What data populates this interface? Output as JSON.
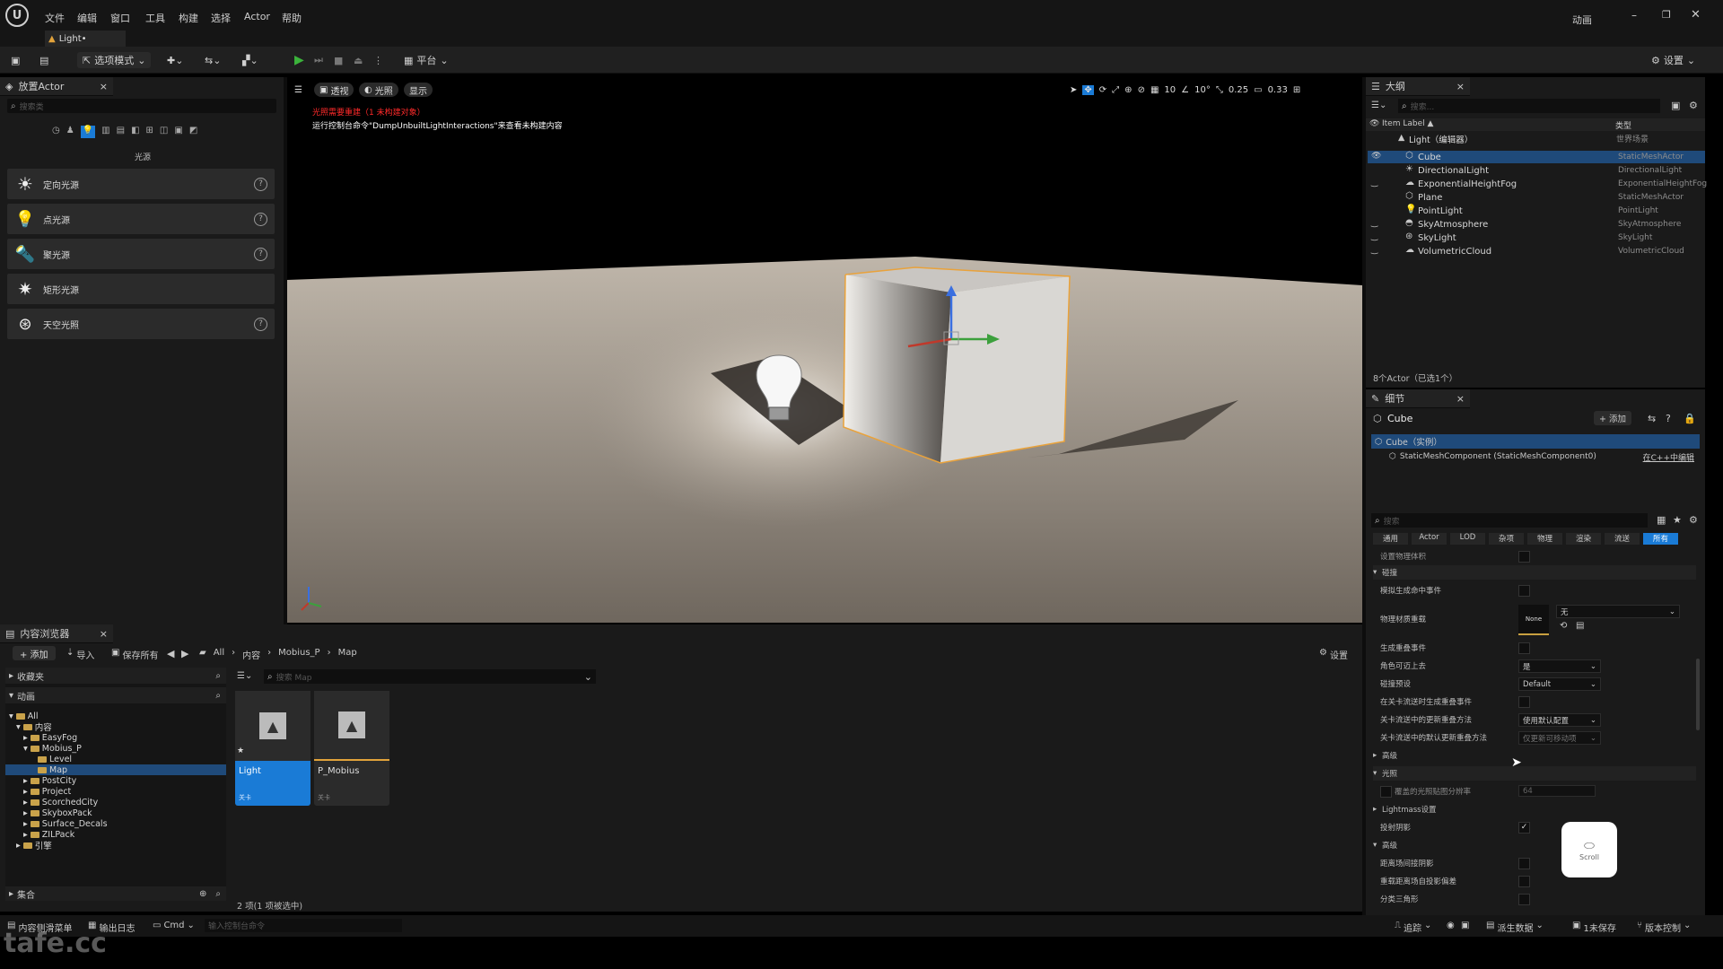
{
  "menu": {
    "items": [
      "文件",
      "编辑",
      "窗口",
      "工具",
      "构建",
      "选择",
      "Actor",
      "帮助"
    ],
    "right_label": "动画"
  },
  "tab": {
    "title": "Light•"
  },
  "toolbar": {
    "mode_label": "选项模式",
    "platform_label": "平台",
    "settings_label": "设置"
  },
  "place_actor": {
    "title": "放置Actor",
    "search_placeholder": "搜索类",
    "category_label": "光源",
    "items": [
      {
        "label": "定向光源",
        "icon": "sun-icon"
      },
      {
        "label": "点光源",
        "icon": "bulb-icon"
      },
      {
        "label": "聚光源",
        "icon": "spotlight-icon"
      },
      {
        "label": "矩形光源",
        "icon": "rect-light-icon"
      },
      {
        "label": "天空光照",
        "icon": "skylight-icon"
      }
    ]
  },
  "viewport": {
    "view_label": "透视",
    "lit_label": "光照",
    "show_label": "显示",
    "warning_red": "光照需要重建（1 未构建对象）",
    "warning_white": "运行控制台命令\"DumpUnbuiltLightInteractions\"来查看未构建内容",
    "grid_value": "10",
    "rot_value": "10°",
    "scale_value": "0.25",
    "cam_speed": "0.33"
  },
  "outliner": {
    "title": "大纲",
    "search_placeholder": "搜索...",
    "col_label": "Item Label ▲",
    "col_type": "类型",
    "root_label": "Light（编辑器）",
    "root_type": "世界场景",
    "rows": [
      {
        "name": "Cube",
        "type": "StaticMeshActor",
        "selected": true
      },
      {
        "name": "DirectionalLight",
        "type": "DirectionalLight"
      },
      {
        "name": "ExponentialHeightFog",
        "type": "ExponentialHeightFog"
      },
      {
        "name": "Plane",
        "type": "StaticMeshActor"
      },
      {
        "name": "PointLight",
        "type": "PointLight"
      },
      {
        "name": "SkyAtmosphere",
        "type": "SkyAtmosphere"
      },
      {
        "name": "SkyLight",
        "type": "SkyLight"
      },
      {
        "name": "VolumetricCloud",
        "type": "VolumetricCloud"
      }
    ],
    "footer": "8个Actor（已选1个）"
  },
  "details": {
    "title": "细节",
    "object_name": "Cube",
    "add_label": "+ 添加",
    "instance_label": "Cube（实例）",
    "component_label": "StaticMeshComponent (StaticMeshComponent0)",
    "edit_cpp_label": "在C++中编辑",
    "search_placeholder": "搜索",
    "filter_tabs": [
      "通用",
      "Actor",
      "LOD",
      "杂项",
      "物理",
      "渲染",
      "流送",
      "所有"
    ],
    "active_tab": "所有",
    "top_row": "设置物理体积",
    "collision_header": "碰撞",
    "collision_rows": [
      {
        "label": "模拟生成命中事件",
        "kind": "checkbox"
      },
      {
        "label": "物理材质重载",
        "kind": "material"
      },
      {
        "label": "生成重叠事件",
        "kind": "checkbox"
      },
      {
        "label": "角色可迈上去",
        "kind": "dropdown",
        "value": "是"
      },
      {
        "label": "碰撞预设",
        "kind": "dropdown",
        "value": "Default"
      },
      {
        "label": "在关卡流送时生成重叠事件",
        "kind": "checkbox"
      },
      {
        "label": "关卡流送中的更新重叠方法",
        "kind": "dropdown",
        "value": "使用默认配置"
      },
      {
        "label": "关卡流送中的默认更新重叠方法",
        "kind": "dropdown",
        "value": "仅更新可移动项"
      }
    ],
    "material_none": "None",
    "material_value": "无",
    "advanced_label": "高级",
    "lighting_header": "光照",
    "override_light_res": "覆盖的光照贴图分辨率",
    "override_light_res_value": "64",
    "lightmass_label": "Lightmass设置",
    "cast_shadow_label": "投射阴影",
    "advanced2_label": "高级",
    "adv_rows": [
      "距离场间接阴影",
      "重载距离场自投影偏差",
      "分类三角形"
    ],
    "scroll_hint": "Scroll"
  },
  "content_browser": {
    "title": "内容浏览器",
    "add_label": "+ 添加",
    "import_label": "导入",
    "save_all_label": "保存所有",
    "path": [
      "All",
      "内容",
      "Mobius_P",
      "Map"
    ],
    "settings_label": "设置",
    "favorites_label": "收藏夹",
    "project_label": "动画",
    "search_placeholder": "搜索 Map",
    "tree": [
      {
        "label": "All",
        "depth": 0
      },
      {
        "label": "内容",
        "depth": 1
      },
      {
        "label": "EasyFog",
        "depth": 2
      },
      {
        "label": "Mobius_P",
        "depth": 2
      },
      {
        "label": "Level",
        "depth": 3
      },
      {
        "label": "Map",
        "depth": 3,
        "selected": true
      },
      {
        "label": "PostCity",
        "depth": 2
      },
      {
        "label": "Project",
        "depth": 2
      },
      {
        "label": "ScorchedCity",
        "depth": 2
      },
      {
        "label": "SkyboxPack",
        "depth": 2
      },
      {
        "label": "Surface_Decals",
        "depth": 2
      },
      {
        "label": "ZILPack",
        "depth": 2
      },
      {
        "label": "引擎",
        "depth": 1
      }
    ],
    "collections_label": "集合",
    "assets": [
      {
        "name": "Light",
        "sub": "关卡",
        "selected": true
      },
      {
        "name": "P_Mobius",
        "sub": "关卡",
        "selected": false
      }
    ],
    "status": "2 项(1 项被选中)"
  },
  "statusbar": {
    "drawer_label": "内容侧滑菜单",
    "output_label": "输出日志",
    "cmd_label": "Cmd",
    "console_placeholder": "输入控制台命令",
    "trace_label": "追踪",
    "derived_label": "派生数据",
    "unsaved_label": "1未保存",
    "revision_label": "版本控制"
  },
  "watermark": "tafe.cc",
  "colors": {
    "accent": "#1a7bd6",
    "selection": "#1f4a7a",
    "warning": "#ff2a2a",
    "play_green": "#3bb33b"
  }
}
